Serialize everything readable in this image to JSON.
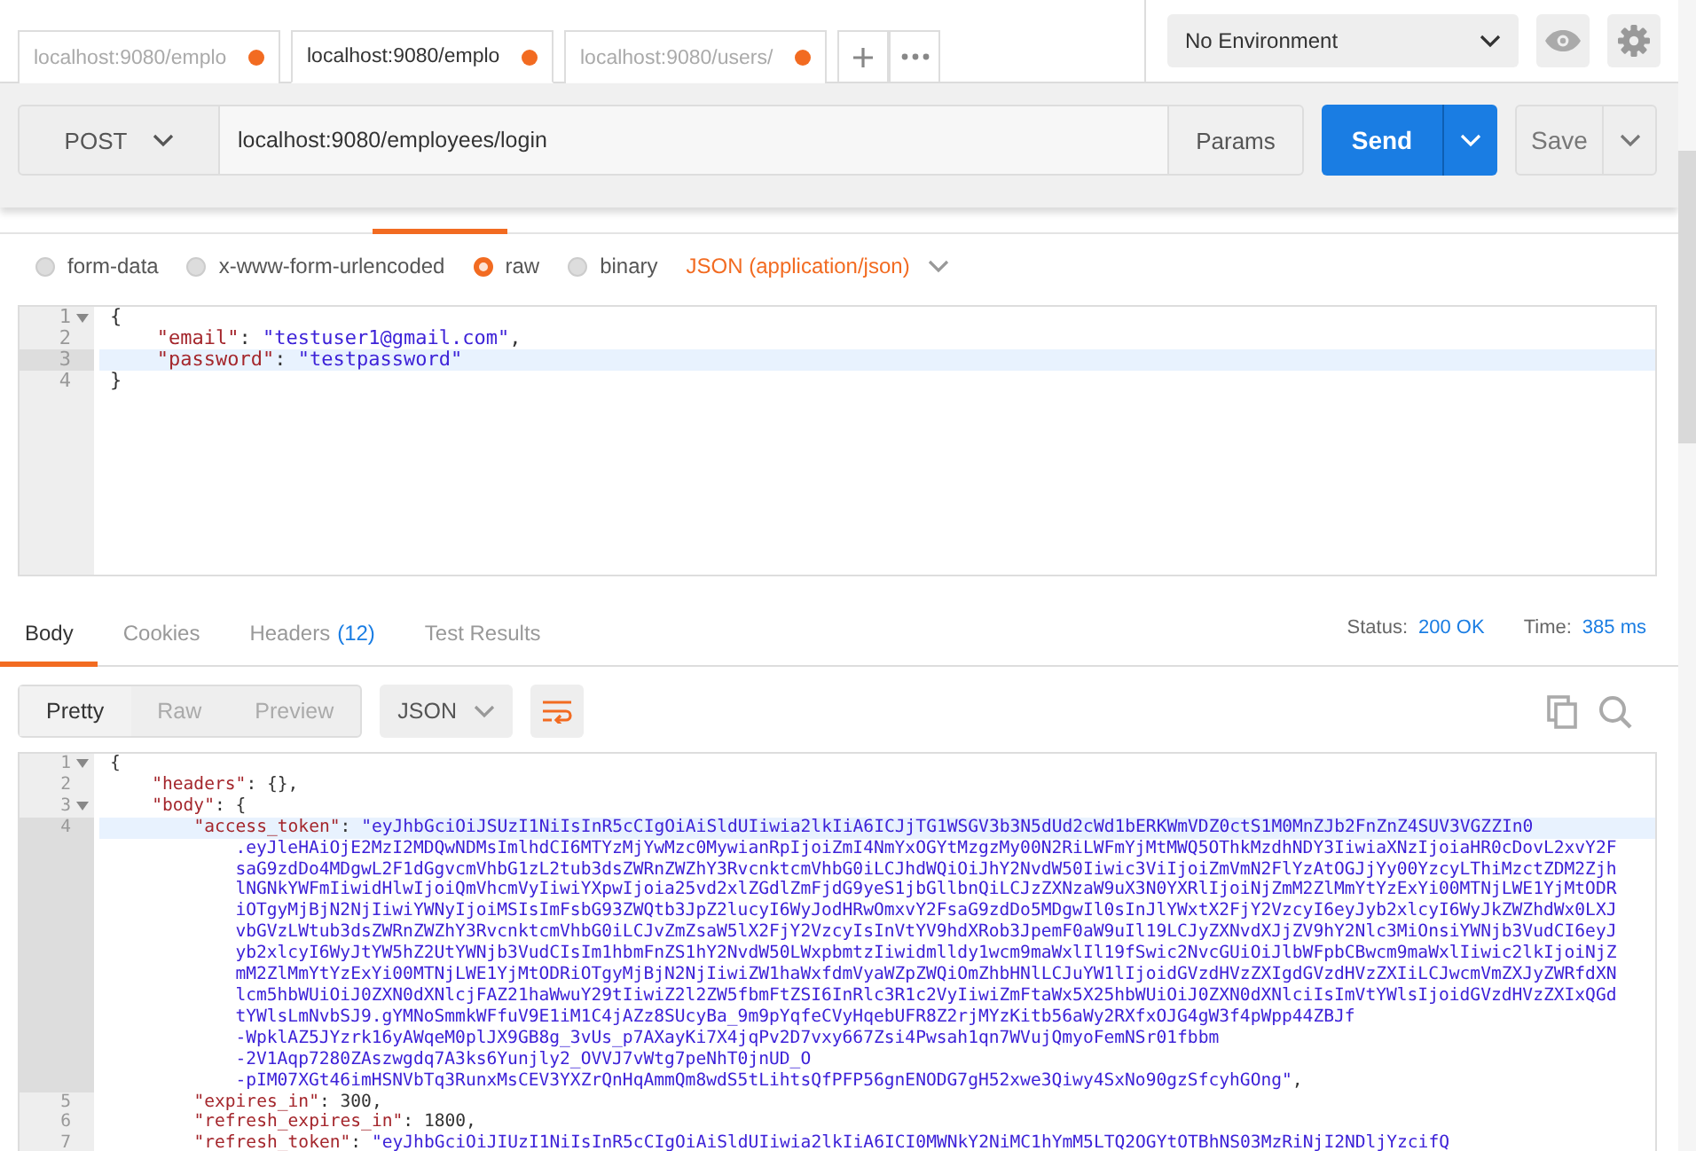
{
  "tabs": [
    {
      "label": "localhost:9080/emplo",
      "selected": false,
      "unsaved": true
    },
    {
      "label": "localhost:9080/emplo",
      "selected": true,
      "unsaved": true
    },
    {
      "label": "localhost:9080/users/",
      "selected": false,
      "unsaved": true
    }
  ],
  "environment": {
    "label": "No Environment"
  },
  "request": {
    "method": "POST",
    "url": "localhost:9080/employees/login",
    "params_label": "Params",
    "send_label": "Send",
    "save_label": "Save"
  },
  "body_modes": [
    {
      "label": "form-data",
      "selected": false
    },
    {
      "label": "x-www-form-urlencoded",
      "selected": false
    },
    {
      "label": "raw",
      "selected": true
    },
    {
      "label": "binary",
      "selected": false
    }
  ],
  "content_type": "JSON (application/json)",
  "request_body": {
    "lines": [
      {
        "number": "1",
        "fold": true,
        "active": false,
        "segments": [
          {
            "kind": "punct",
            "text": "{"
          }
        ]
      },
      {
        "number": "2",
        "fold": false,
        "active": false,
        "segments": [
          {
            "kind": "key",
            "text": "\"email\""
          },
          {
            "kind": "punct",
            "text": ": "
          },
          {
            "kind": "string",
            "text": "\"testuser1@gmail.com\""
          },
          {
            "kind": "punct",
            "text": ","
          }
        ]
      },
      {
        "number": "3",
        "fold": false,
        "active": true,
        "segments": [
          {
            "kind": "key",
            "text": "\"password\""
          },
          {
            "kind": "punct",
            "text": ": "
          },
          {
            "kind": "string",
            "text": "\"testpassword\""
          }
        ]
      },
      {
        "number": "4",
        "fold": false,
        "active": false,
        "segments": [
          {
            "kind": "punct",
            "text": "}"
          }
        ]
      }
    ]
  },
  "response_tabs": [
    {
      "label": "Body",
      "selected": true
    },
    {
      "label": "Cookies",
      "selected": false
    },
    {
      "label": "Headers",
      "count": "(12)",
      "selected": false
    },
    {
      "label": "Test Results",
      "selected": false
    }
  ],
  "status": {
    "label": "Status:",
    "value": "200 OK"
  },
  "time": {
    "label": "Time:",
    "value": "385 ms"
  },
  "view_modes": [
    {
      "label": "Pretty",
      "selected": true
    },
    {
      "label": "Raw",
      "selected": false
    },
    {
      "label": "Preview",
      "selected": false
    }
  ],
  "format": "JSON",
  "wrap_lines": true,
  "response_body": {
    "lines": [
      {
        "number": "1",
        "fold": true,
        "active": false,
        "segments": [
          {
            "kind": "punct",
            "text": "{"
          }
        ]
      },
      {
        "number": "2",
        "fold": false,
        "active": false,
        "segments": [
          {
            "kind": "key",
            "text": "\"headers\""
          },
          {
            "kind": "punct",
            "text": ": {},"
          }
        ]
      },
      {
        "number": "3",
        "fold": true,
        "active": false,
        "segments": [
          {
            "kind": "key",
            "text": "\"body\""
          },
          {
            "kind": "punct",
            "text": ": {"
          }
        ]
      },
      {
        "number": "4",
        "fold": false,
        "active": true,
        "segments": [
          {
            "kind": "key",
            "text": "\"access_token\""
          },
          {
            "kind": "punct",
            "text": ": "
          },
          {
            "kind": "string",
            "text": "\"eyJhbGciOiJSUzI1NiIsInR5cCIgOiAiSldUIiwia2lkIiA6ICJjTG1WSGV3b3N5dUd2cWd1bERKWmVDZ0ctS1M0MnZJb2FnZnZ4SUV3VGZZIn0"
          }
        ]
      },
      {
        "active": true,
        "segments": [
          {
            "kind": "string",
            "text": ".eyJleHAiOjE2MzI2MDQwNDMsImlhdCI6MTYzMjYwMzc0MywianRpIjoiZmI4NmYxOGYtMzgzMy00N2RiLWFmYjMtMWQ5OThkMzdhNDY3IiwiaXNzIjoiaHR0cDovL2xvY2F"
          }
        ]
      },
      {
        "active": true,
        "segments": [
          {
            "kind": "string",
            "text": "saG9zdDo4MDgwL2F1dGgvcmVhbG1zL2tub3dsZWRnZWZhY3RvcnktcmVhbG0iLCJhdWQiOiJhY2NvdW50Iiwic3ViIjoiZmVmN2FlYzAtOGJjYy00YzcyLThiMzctZDM2Zjh"
          }
        ]
      },
      {
        "active": true,
        "segments": [
          {
            "kind": "string",
            "text": "lNGNkYWFmIiwidHlwIjoiQmVhcmVyIiwiYXpwIjoia25vd2xlZGdlZmFjdG9yeS1jbGllbnQiLCJzZXNzaW9uX3N0YXRlIjoiNjZmM2ZlMmYtYzExYi00MTNjLWE1YjMtODR"
          }
        ]
      },
      {
        "active": true,
        "segments": [
          {
            "kind": "string",
            "text": "iOTgyMjBjN2NjIiwiYWNyIjoiMSIsImFsbG93ZWQtb3JpZ2lucyI6WyJodHRwOmxvY2FsaG9zdDo5MDgwIl0sInJlYWxtX2FjY2VzcyI6eyJyb2xlcyI6WyJkZWZhdWx0LXJ"
          }
        ]
      },
      {
        "active": true,
        "segments": [
          {
            "kind": "string",
            "text": "vbGVzLWtub3dsZWRnZWZhY3RvcnktcmVhbG0iLCJvZmZsaW5lX2FjY2VzcyIsInVtYV9hdXRob3JpemF0aW9uIl19LCJyZXNvdXJjZV9hY2Nlc3MiOnsiYWNjb3VudCI6eyJ"
          }
        ]
      },
      {
        "active": true,
        "segments": [
          {
            "kind": "string",
            "text": "yb2xlcyI6WyJtYW5hZ2UtYWNjb3VudCIsIm1hbmFnZS1hY2NvdW50LWxpbmtzIiwidmlldy1wcm9maWxlIl19fSwic2NvcGUiOiJlbWFpbCBwcm9maWxlIiwic2lkIjoiNjZ"
          }
        ]
      },
      {
        "active": true,
        "segments": [
          {
            "kind": "string",
            "text": "mM2ZlMmYtYzExYi00MTNjLWE1YjMtODRiOTgyMjBjN2NjIiwiZW1haWxfdmVyaWZpZWQiOmZhbHNlLCJuYW1lIjoidGVzdHVzZXIgdGVzdHVzZXIiLCJwcmVmZXJyZWRfdXN"
          }
        ]
      },
      {
        "active": true,
        "segments": [
          {
            "kind": "string",
            "text": "lcm5hbWUiOiJ0ZXN0dXNlcjFAZ21haWwuY29tIiwiZ2l2ZW5fbmFtZSI6InRlc3R1c2VyIiwiZmFtaWx5X25hbWUiOiJ0ZXN0dXNlciIsImVtYWlsIjoidGVzdHVzZXIxQGd"
          }
        ]
      },
      {
        "active": true,
        "segments": [
          {
            "kind": "string",
            "text": "tYWlsLmNvbSJ9.gYMNoSmmkWFfuV9E1iM1C4jAZz8SUcyBa_9m9pYqfeCVyHqebUFR8Z2rjMYzKitb56aWy2RXfxOJG4gW3f4pWpp44ZBJf"
          }
        ]
      },
      {
        "active": true,
        "segments": [
          {
            "kind": "string",
            "text": "-WpklAZ5JYzrk16yAWqeM0plJX9GB8g_3vUs_p7AXayKi7X4jqPv2D7vxy667Zsi4Pwsah1qn7WVujQmyoFemNSr01fbbm"
          }
        ]
      },
      {
        "active": true,
        "segments": [
          {
            "kind": "string",
            "text": "-2V1Aqp7280ZAszwgdq7A3ks6Yunjly2_OVVJ7vWtg7peNhT0jnUD_O"
          }
        ]
      },
      {
        "active": true,
        "segments": [
          {
            "kind": "string",
            "text": "-pIM07XGt46imHSNVbTq3RunxMsCEV3YXZrQnHqAmmQm8wdS5tLihtsQfPFP56gnENODG7gH52xwe3Qiwy4SxNo90gzSfcyhGOng\""
          },
          {
            "kind": "punct",
            "text": ","
          }
        ]
      },
      {
        "number": "5",
        "fold": false,
        "active": false,
        "segments": [
          {
            "kind": "key",
            "text": "\"expires_in\""
          },
          {
            "kind": "punct",
            "text": ": "
          },
          {
            "kind": "number",
            "text": "300"
          },
          {
            "kind": "punct",
            "text": ","
          }
        ]
      },
      {
        "number": "6",
        "fold": false,
        "active": false,
        "segments": [
          {
            "kind": "key",
            "text": "\"refresh_expires_in\""
          },
          {
            "kind": "punct",
            "text": ": "
          },
          {
            "kind": "number",
            "text": "1800"
          },
          {
            "kind": "punct",
            "text": ","
          }
        ]
      },
      {
        "number": "7",
        "fold": false,
        "active": false,
        "segments": [
          {
            "kind": "key",
            "text": "\"refresh_token\""
          },
          {
            "kind": "punct",
            "text": ": "
          },
          {
            "kind": "string",
            "text": "\"eyJhbGciOiJIUzI1NiIsInR5cCIgOiAiSldUIiwia2lkIiA6ICI0MWNkY2NiMC1hYmM5LTQ2OGYtOTBhNS03MzRiNjI2NDljYzcifQ"
          }
        ]
      }
    ]
  }
}
